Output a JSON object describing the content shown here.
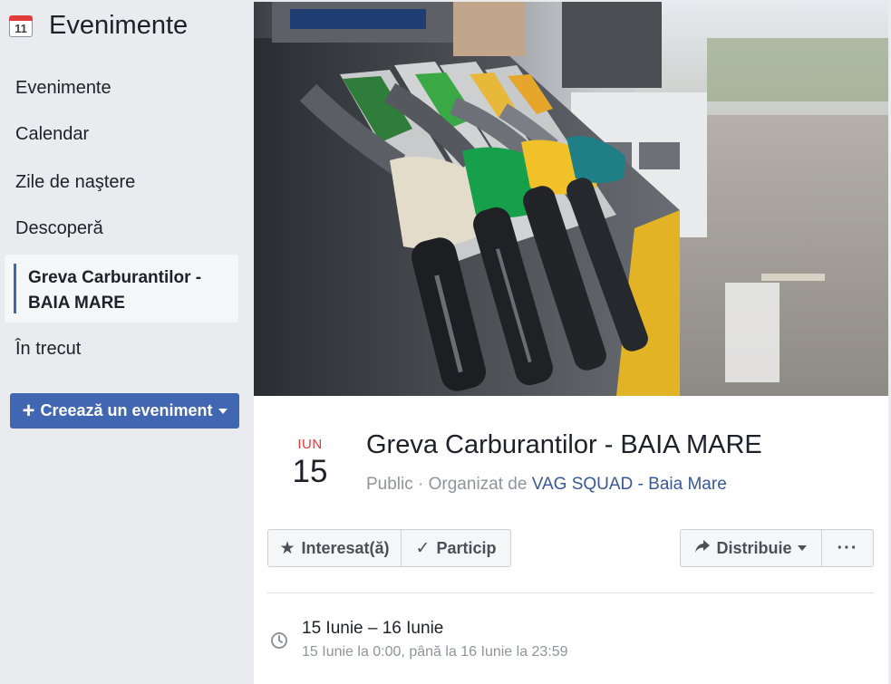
{
  "sidebar": {
    "title": "Evenimente",
    "calendar_icon_day": "11",
    "items": [
      {
        "label": "Evenimente"
      },
      {
        "label": "Calendar"
      },
      {
        "label": "Zile de naştere"
      },
      {
        "label": "Descoperă"
      },
      {
        "label": "Greva Carburantilor - BAIA MARE"
      },
      {
        "label": "În trecut"
      }
    ],
    "create_button": "Creează un eveniment",
    "create_button_icon": "plus-icon"
  },
  "event": {
    "cover_image": "fuel-pump-nozzles-photo",
    "month": "IUN",
    "day": "15",
    "title": "Greva Carburantilor - BAIA MARE",
    "privacy": "Public",
    "organized_by_prefix": "· Organizat de",
    "organizer": "VAG SQUAD - Baia Mare",
    "actions": {
      "interested": "Interesat(ă)",
      "going": "Particip",
      "share": "Distribuie",
      "more": "···"
    },
    "time": {
      "range": "15 Iunie – 16 Iunie",
      "detail": "15 Iunie la 0:00, până la 16 Iunie la 23:59"
    }
  },
  "colors": {
    "accent": "#4267b2",
    "month": "#e0393e",
    "link": "#385898"
  }
}
